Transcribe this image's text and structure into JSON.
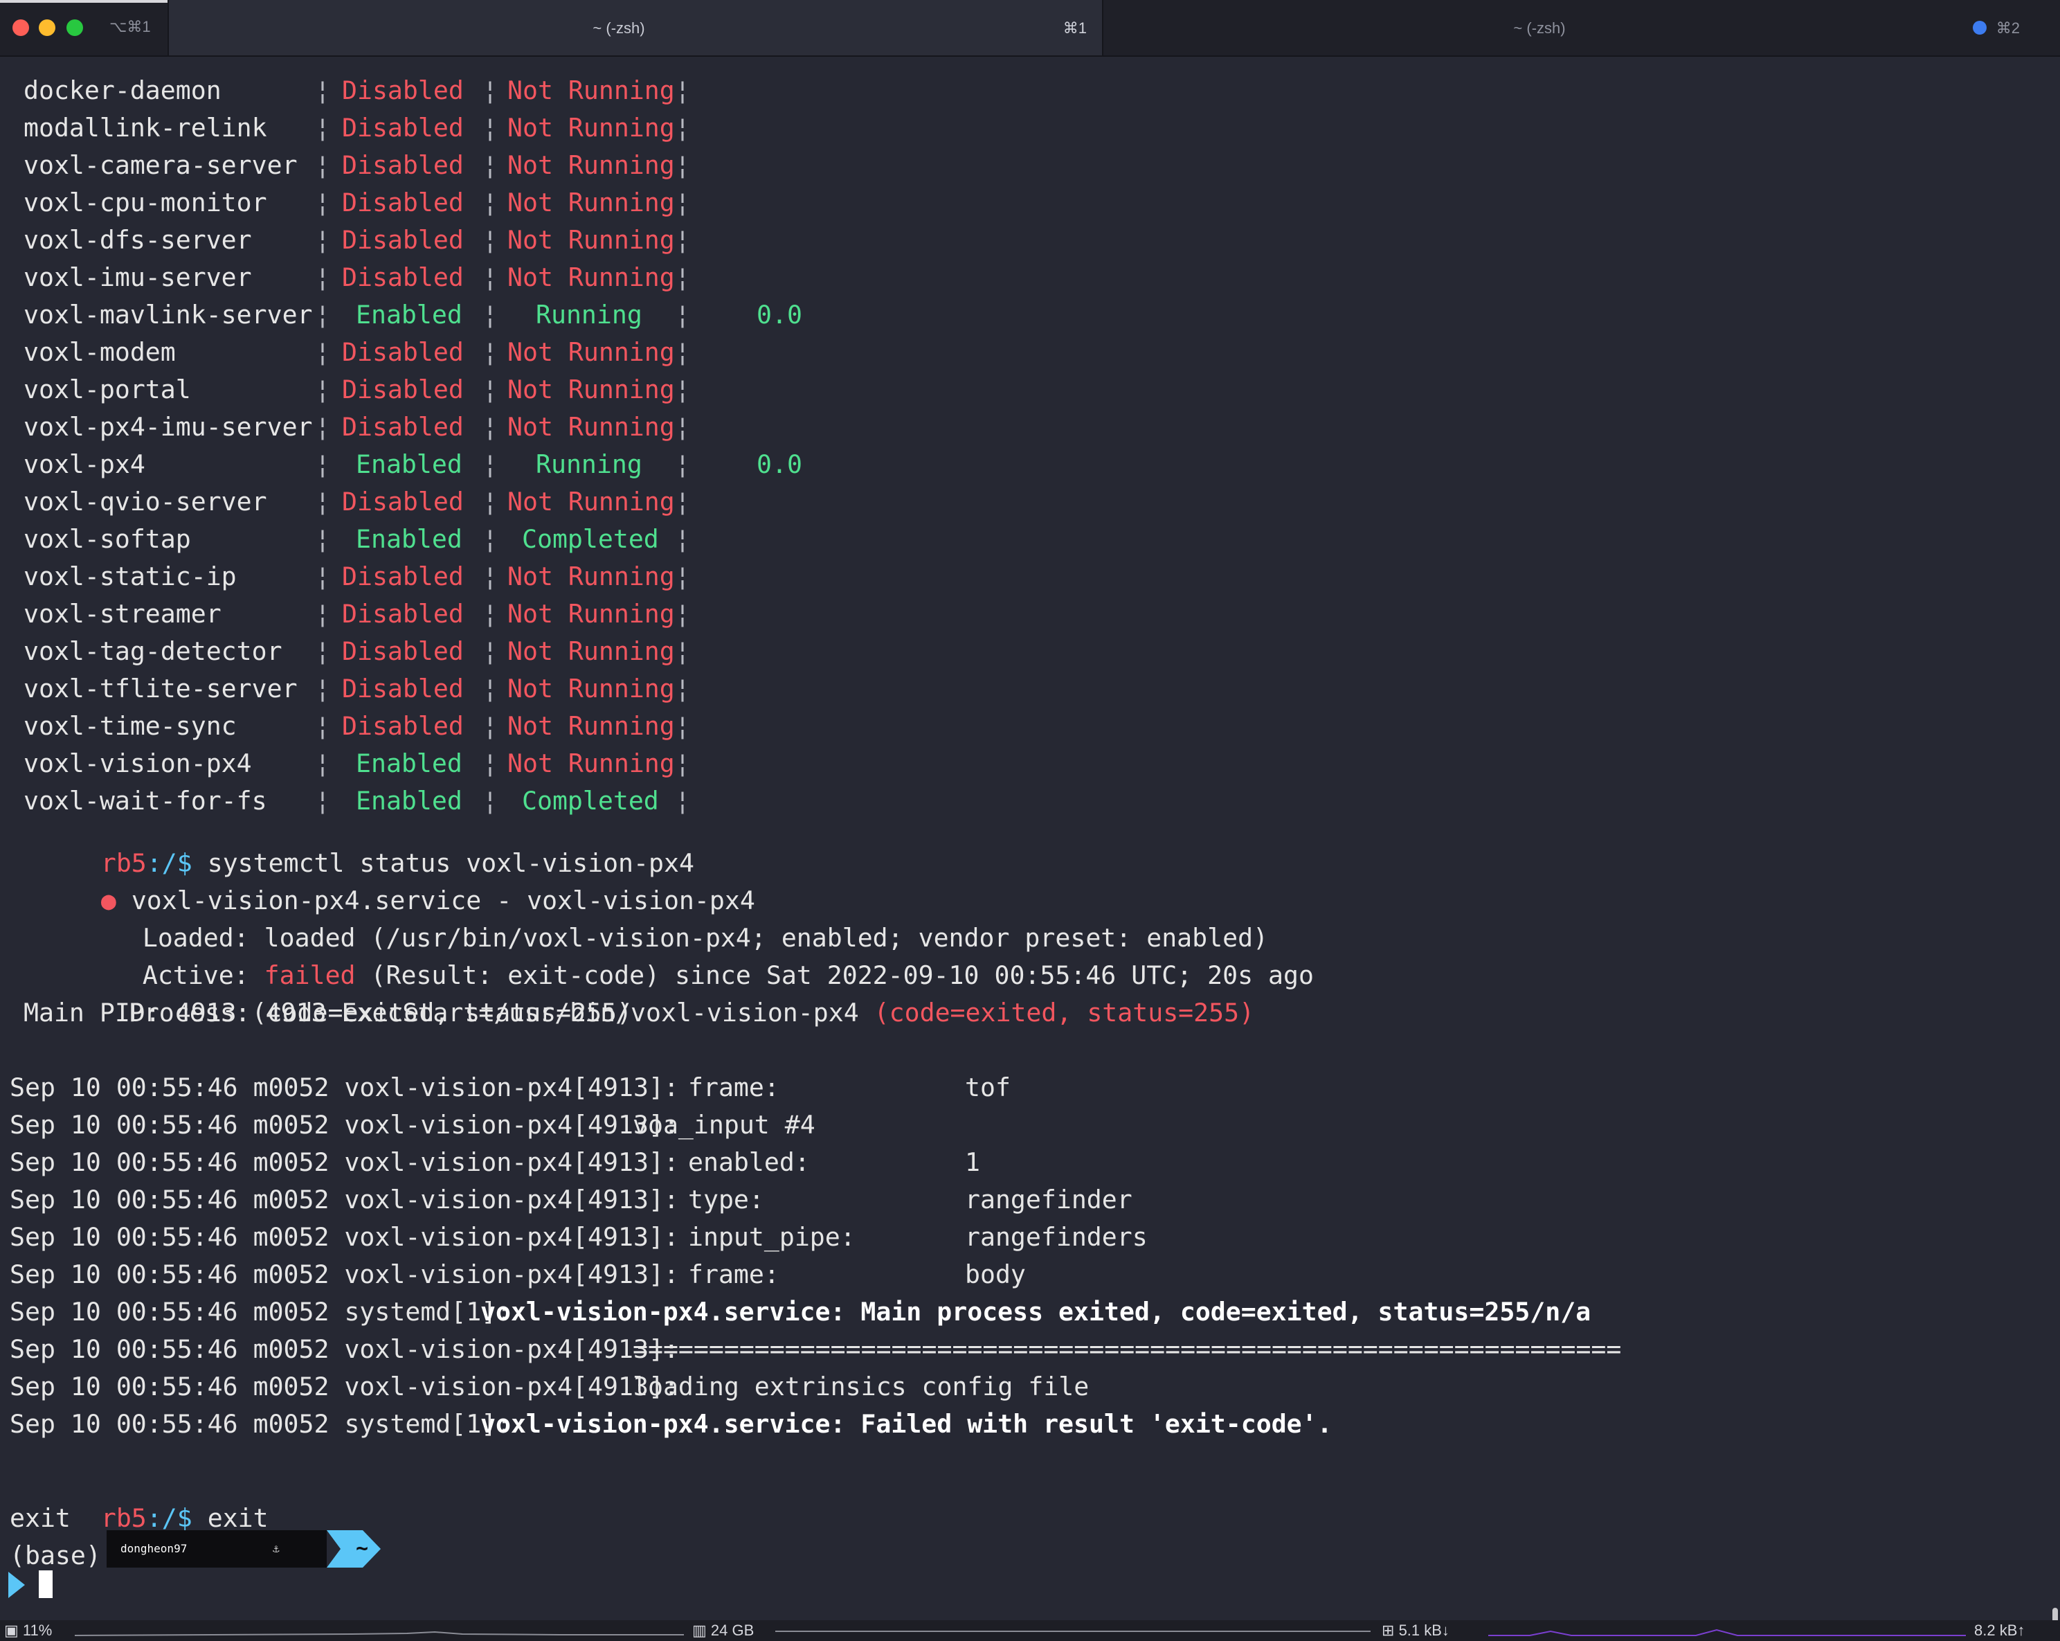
{
  "window": {
    "shortcut": "⌥⌘1",
    "tabs": [
      {
        "title": "~ (-zsh)",
        "shortcut": "⌘1"
      },
      {
        "title": "~ (-zsh)",
        "shortcut": "⌘2"
      }
    ]
  },
  "services": [
    {
      "name": "docker-daemon",
      "enabled": "Disabled",
      "running": "Not Running",
      "cpu": ""
    },
    {
      "name": "modallink-relink",
      "enabled": "Disabled",
      "running": "Not Running",
      "cpu": ""
    },
    {
      "name": "voxl-camera-server",
      "enabled": "Disabled",
      "running": "Not Running",
      "cpu": ""
    },
    {
      "name": "voxl-cpu-monitor",
      "enabled": "Disabled",
      "running": "Not Running",
      "cpu": ""
    },
    {
      "name": "voxl-dfs-server",
      "enabled": "Disabled",
      "running": "Not Running",
      "cpu": ""
    },
    {
      "name": "voxl-imu-server",
      "enabled": "Disabled",
      "running": "Not Running",
      "cpu": ""
    },
    {
      "name": "voxl-mavlink-server",
      "enabled": "Enabled",
      "running": "Running",
      "cpu": "0.0"
    },
    {
      "name": "voxl-modem",
      "enabled": "Disabled",
      "running": "Not Running",
      "cpu": ""
    },
    {
      "name": "voxl-portal",
      "enabled": "Disabled",
      "running": "Not Running",
      "cpu": ""
    },
    {
      "name": "voxl-px4-imu-server",
      "enabled": "Disabled",
      "running": "Not Running",
      "cpu": ""
    },
    {
      "name": "voxl-px4",
      "enabled": "Enabled",
      "running": "Running",
      "cpu": "0.0"
    },
    {
      "name": "voxl-qvio-server",
      "enabled": "Disabled",
      "running": "Not Running",
      "cpu": ""
    },
    {
      "name": "voxl-softap",
      "enabled": "Enabled",
      "running": "Completed",
      "cpu": ""
    },
    {
      "name": "voxl-static-ip",
      "enabled": "Disabled",
      "running": "Not Running",
      "cpu": ""
    },
    {
      "name": "voxl-streamer",
      "enabled": "Disabled",
      "running": "Not Running",
      "cpu": ""
    },
    {
      "name": "voxl-tag-detector",
      "enabled": "Disabled",
      "running": "Not Running",
      "cpu": ""
    },
    {
      "name": "voxl-tflite-server",
      "enabled": "Disabled",
      "running": "Not Running",
      "cpu": ""
    },
    {
      "name": "voxl-time-sync",
      "enabled": "Disabled",
      "running": "Not Running",
      "cpu": ""
    },
    {
      "name": "voxl-vision-px4",
      "enabled": "Enabled",
      "running": "Not Running",
      "cpu": ""
    },
    {
      "name": "voxl-wait-for-fs",
      "enabled": "Enabled",
      "running": "Completed",
      "cpu": ""
    }
  ],
  "column_separator": "¦",
  "prompt": {
    "host": "rb5",
    "path": ":/$"
  },
  "commands": {
    "status": "systemctl status voxl-vision-px4",
    "exit": "exit",
    "exit_echo": "exit"
  },
  "status_output": {
    "bullet": "●",
    "unit_line": "voxl-vision-px4.service - voxl-vision-px4",
    "loaded_label": "Loaded:",
    "loaded_value": "loaded (/usr/bin/voxl-vision-px4; enabled; vendor preset: enabled)",
    "active_label": "Active:",
    "active_state": "failed",
    "active_rest": "(Result: exit-code) since Sat 2022-09-10 00:55:46 UTC; 20s ago",
    "process_label": "Process:",
    "process_value": "4913 ExecStart=/usr/bin/voxl-vision-px4",
    "process_code": "(code=exited, status=255)",
    "mainpid": "Main PID: 4913 (code=exited, status=255)"
  },
  "journal": [
    {
      "prefix": "Sep 10 00:55:46 m0052 voxl-vision-px4[4913]:",
      "key": "frame:",
      "value": "tof",
      "msg": ""
    },
    {
      "prefix": "Sep 10 00:55:46 m0052 voxl-vision-px4[4913]:",
      "key": "",
      "value": "",
      "msg": "voa_input #4"
    },
    {
      "prefix": "Sep 10 00:55:46 m0052 voxl-vision-px4[4913]:",
      "key": "enabled:",
      "value": "1",
      "msg": ""
    },
    {
      "prefix": "Sep 10 00:55:46 m0052 voxl-vision-px4[4913]:",
      "key": "type:",
      "value": "rangefinder",
      "msg": ""
    },
    {
      "prefix": "Sep 10 00:55:46 m0052 voxl-vision-px4[4913]:",
      "key": "input_pipe:",
      "value": "rangefinders",
      "msg": ""
    },
    {
      "prefix": "Sep 10 00:55:46 m0052 voxl-vision-px4[4913]:",
      "key": "frame:",
      "value": "body",
      "msg": ""
    },
    {
      "prefix": "Sep 10 00:55:46 m0052 systemd[1]:",
      "key": "",
      "value": "",
      "msg": "voxl-vision-px4.service: Main process exited, code=exited, status=255/n/a",
      "bold": true
    },
    {
      "prefix": "Sep 10 00:55:46 m0052 voxl-vision-px4[4913]:",
      "key": "",
      "value": "",
      "msg": "================================================================="
    },
    {
      "prefix": "Sep 10 00:55:46 m0052 voxl-vision-px4[4913]:",
      "key": "",
      "value": "",
      "msg": "loading extrinsics config file"
    },
    {
      "prefix": "Sep 10 00:55:46 m0052 systemd[1]:",
      "key": "",
      "value": "",
      "msg": "voxl-vision-px4.service: Failed with result 'exit-code'.",
      "bold": true
    }
  ],
  "shell_prompt": {
    "env": "(base)",
    "user": "dongheon97",
    "anchor": "⚓",
    "dir": "~"
  },
  "statusbar": {
    "cpu": "11%",
    "memory": "24 GB",
    "net_down": "5.1 kB↓",
    "net_up": "8.2 kB↑"
  },
  "colors": {
    "background": "#262833",
    "disabled": "#f2565f",
    "enabled": "#4fe08f",
    "prompt_host": "#f2565f",
    "prompt_path": "#5bc6f7"
  }
}
